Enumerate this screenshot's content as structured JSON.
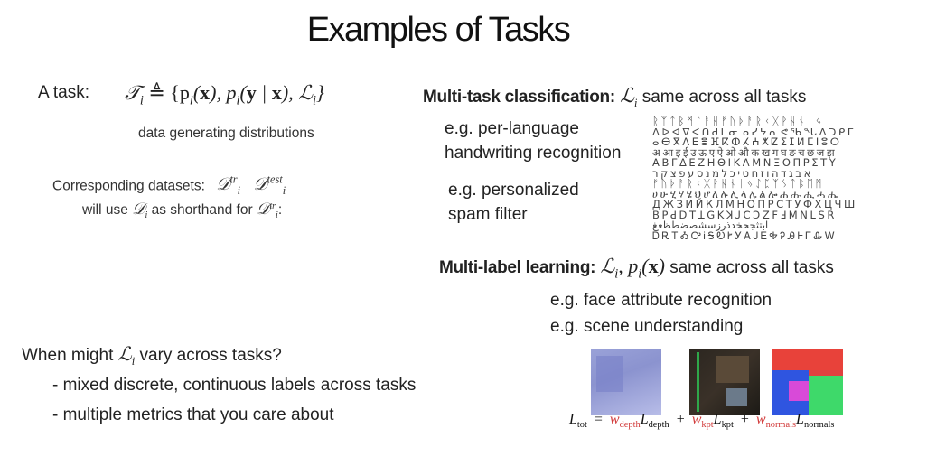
{
  "title": "Examples of Tasks",
  "left": {
    "task_label": "A task:",
    "task_symbol": "𝒯",
    "task_def": "≜ {p",
    "data_gen": "data generating distributions",
    "datasets_label": "Corresponding datasets:",
    "dataset_symbol": "𝒟",
    "sup_tr": "tr",
    "sup_test": "test",
    "shorthand_a": "will use",
    "shorthand_b": "as shorthand for",
    "vary_q_a": "When might",
    "vary_q_b": "vary across tasks?",
    "bullets": [
      "- mixed discrete, continuous labels across tasks",
      "- multiple metrics that you care about"
    ]
  },
  "right": {
    "mtc_heading": "Multi-task classification:",
    "mtc_same": "same across all tasks",
    "mtc_examples": [
      "e.g. per-language",
      "handwriting recognition",
      "e.g. personalized",
      "spam filter"
    ],
    "mll_heading": "Multi-label learning:",
    "mll_same": "same across all tasks",
    "mll_examples": [
      "e.g. face attribute recognition",
      "e.g. scene understanding"
    ],
    "loss_symbol": "ℒ",
    "formula": {
      "lhs": "L",
      "lhs_sub": "tot",
      "w": "w",
      "L": "L",
      "subs": [
        "depth",
        "kpt",
        "normals"
      ]
    }
  },
  "handwriting_rows": [
    "ᚱᛉᛏᛒᛗᛚᚨᚺᚠᚢᚦᚨᚱᚲᚷᚹᚺᚾᛁᛃ",
    "ᐃᐅᐊᐁᐸᑎᑯᒪᓂᓄᓯᔭᕆᕙᖃᖓᐱᑐᑭᒥ",
    "ⴰⴱⴳⴷⴹⴻⴼⴽⵀⵃⵄⵅⵇⵉⵊⵍⵎⵏⵓⵔ",
    "अआइईउऊएऐओऔकखगघङचछजझ",
    "ΑΒΓΔΕΖΗΘΙΚΛΜΝΞΟΠΡΣΤΥ",
    "אבגדהוזחטיכלמנסעפצקר",
    "ᚠᚢᚦᚨᚱᚲᚷᚹᚺᚾᛁᛃᛇᛈᛉᛊᛏᛒᛖᛗ",
    "ሀሁሂሃሄህሆለሉሊላሌልሎሐሑሒሓሔ",
    "ДЖЗИЙКЛМНОПРСТУФХЦЧШ",
    "ꓐꓑꓒꓓꓔꓕꓖꓗꓘꓙꓚꓛꓜꓝꓞꓟꓠꓡꓢꓣ",
    "ابتثجحخدذرزسشصضطظعغ",
    "ᎠᎡᎢᎣᎤᎥᎦᎧᎨᎩᎪᎫᎬᎭᎮᎯᎰᎱᎲᎳ"
  ]
}
